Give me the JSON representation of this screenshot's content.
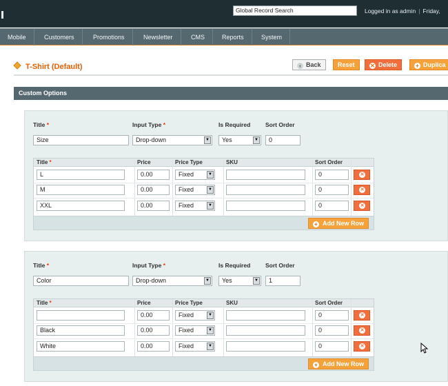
{
  "header": {
    "search_value": "Global Record Search",
    "login_text": "Logged in as admin",
    "date_text": "Friday,"
  },
  "nav": [
    "Mobile",
    "Customers",
    "Promotions",
    "Newsletter",
    "CMS",
    "Reports",
    "System"
  ],
  "page": {
    "title": "T-Shirt (Default)",
    "buttons": {
      "back": "Back",
      "reset": "Reset",
      "delete": "Delete",
      "duplicate": "Duplica"
    }
  },
  "section": {
    "title": "Custom Options"
  },
  "labels": {
    "title": "Title",
    "input_type": "Input Type",
    "is_required": "Is Required",
    "sort_order": "Sort Order",
    "req_star": "*",
    "col_title": "Title",
    "col_price": "Price",
    "col_price_type": "Price Type",
    "col_sku": "SKU",
    "col_sort_order": "Sort Order",
    "add_row": "Add New Row"
  },
  "options": [
    {
      "title": "Size",
      "input_type": "Drop-down",
      "is_required": "Yes",
      "sort_order": "0",
      "rows": [
        {
          "title": "L",
          "price": "0.00",
          "price_type": "Fixed",
          "sku": "",
          "sort_order": "0"
        },
        {
          "title": "M",
          "price": "0.00",
          "price_type": "Fixed",
          "sku": "",
          "sort_order": "0"
        },
        {
          "title": "XXL",
          "price": "0.00",
          "price_type": "Fixed",
          "sku": "",
          "sort_order": "0"
        }
      ]
    },
    {
      "title": "Color",
      "input_type": "Drop-down",
      "is_required": "Yes",
      "sort_order": "1",
      "rows": [
        {
          "title": "",
          "price": "0.00",
          "price_type": "Fixed",
          "sku": "",
          "sort_order": "0"
        },
        {
          "title": "Black",
          "price": "0.00",
          "price_type": "Fixed",
          "sku": "",
          "sort_order": "0"
        },
        {
          "title": "White",
          "price": "0.00",
          "price_type": "Fixed",
          "sku": "",
          "sort_order": "0"
        }
      ]
    }
  ],
  "colors": {
    "accent": "#eb5e00",
    "button": "#f6a23a",
    "delete": "#f26e3c",
    "nav": "#56686f",
    "topbar": "#1f2e33"
  }
}
